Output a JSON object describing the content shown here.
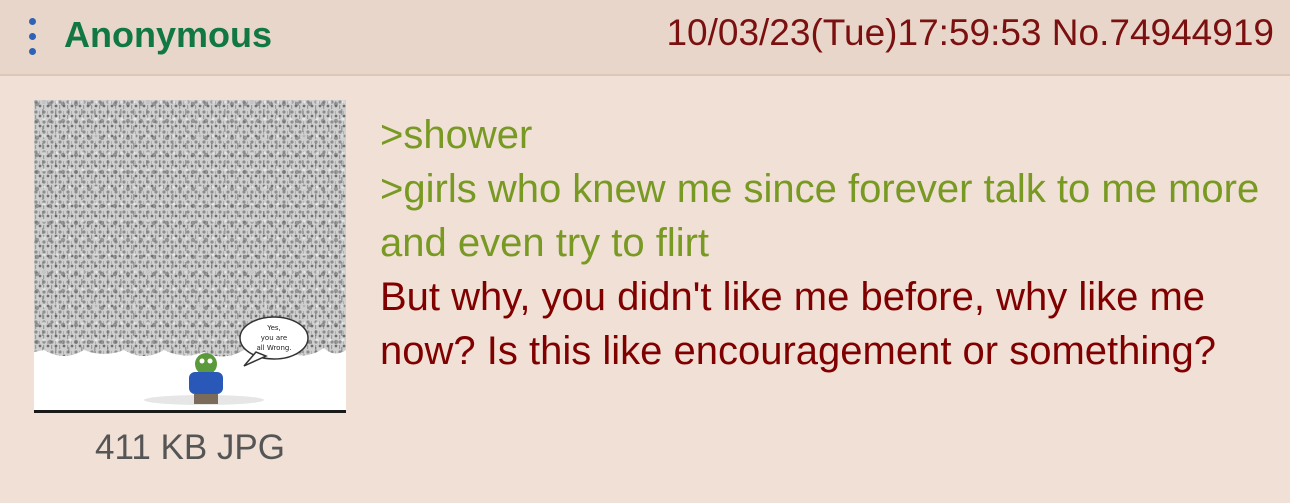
{
  "post": {
    "name": "Anonymous",
    "datetime": "10/03/23(Tue)17:59:53",
    "number": "No.74944919",
    "file_info": "411 KB JPG",
    "thumbnail_speech": [
      "Yes,",
      "you are",
      "all Wrong."
    ],
    "lines": [
      {
        "type": "green",
        "text": ">shower"
      },
      {
        "type": "green",
        "text": ">girls who knew me since forever talk to me more and even try to flirt"
      },
      {
        "type": "normal",
        "text": "But why, you didn't like me before, why like me now? Is this like encouragement or something?"
      }
    ]
  },
  "colors": {
    "header_bg": "#e8d6ca",
    "post_bg": "#f0e0d6",
    "name": "#117743",
    "meta": "#7a1010",
    "greentext": "#789922",
    "text": "#800000",
    "menu_icon": "#2f62b6"
  }
}
